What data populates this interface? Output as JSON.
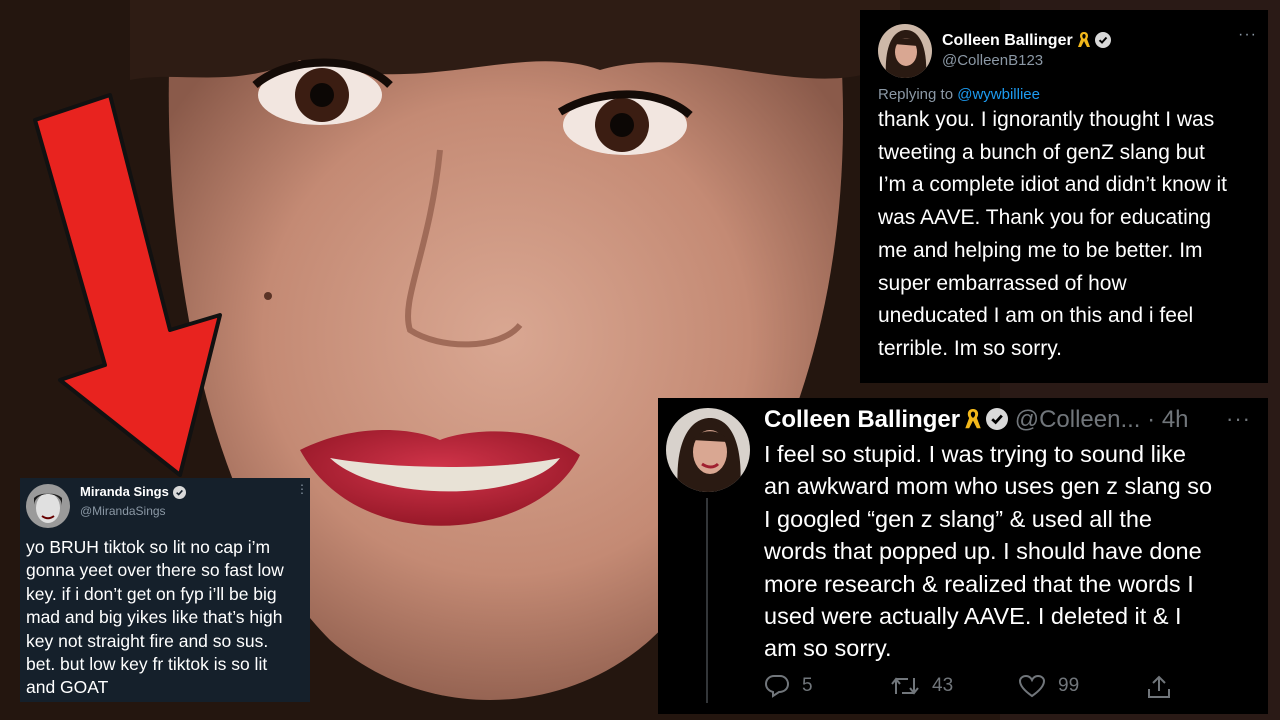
{
  "tweets": {
    "top_right": {
      "display_name": "Colleen Ballinger",
      "handle": "@ColleenB123",
      "more": "···",
      "reply_prefix": "Replying to",
      "reply_to": "@wywbilliee",
      "lines": [
        "thank you. I ignorantly thought I was",
        "tweeting a bunch of genZ slang but",
        "I’m a complete idiot and didn’t know it",
        "was AAVE. Thank you for educating",
        "me and helping me to be better. Im",
        "super embarrassed of how",
        "uneducated I am on this and i feel",
        "terrible. Im so sorry."
      ]
    },
    "bottom_right": {
      "display_name": "Colleen Ballinger",
      "handle": "@Colleen...",
      "time": "· 4h",
      "more": "···",
      "lines": [
        "I feel so stupid. I was trying to sound like",
        "an awkward mom who uses gen z slang so",
        "I googled “gen z slang” & used all the",
        "words that popped up. I should have done",
        "more research & realized that the words I",
        "used were actually AAVE. I deleted it & I",
        "am so sorry."
      ],
      "replies": "5",
      "retweets": "43",
      "likes": "99"
    },
    "bottom_left": {
      "display_name": "Miranda Sings",
      "handle": "@MirandaSings",
      "more": "⋮",
      "lines": [
        "yo BRUH tiktok so lit no cap i’m",
        "gonna yeet over there so fast low",
        "key. if i don’t get on fyp i’ll be big",
        "mad and big yikes like that’s high",
        "key not straight fire and so sus.",
        "bet. but low key fr tiktok is so lit",
        "and GOAT"
      ]
    }
  },
  "icons": {
    "arrow": "red-down-arrow",
    "verified": "verified-badge-icon",
    "ribbon": "awareness-ribbon-icon",
    "reply": "reply-icon",
    "retweet": "retweet-icon",
    "like": "heart-icon",
    "share": "share-icon"
  },
  "colors": {
    "arrow": "#e8231f",
    "tweet_bg_dark": "#000000",
    "tweet_bg_dim": "#15202b",
    "link": "#1d9bf0",
    "ribbon": "#f2b81b",
    "lips": "#b51d2e"
  }
}
